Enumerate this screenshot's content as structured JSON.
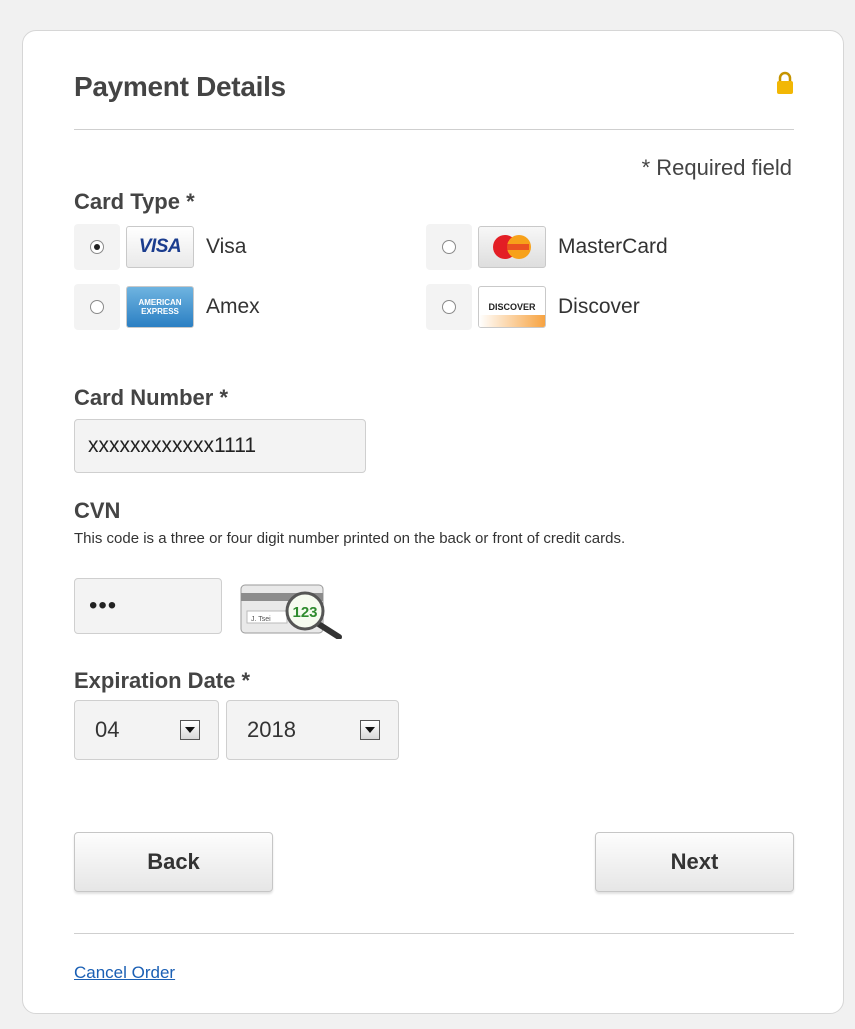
{
  "form": {
    "title": "Payment Details",
    "required_note": "* Required field"
  },
  "card_type": {
    "label": "Card Type *",
    "options": [
      {
        "name": "Visa",
        "logo_text": "VISA",
        "checked": true
      },
      {
        "name": "MasterCard",
        "logo_text": "MasterCard",
        "checked": false
      },
      {
        "name": "Amex",
        "logo_text": "AMERICAN EXPRESS",
        "checked": false
      },
      {
        "name": "Discover",
        "logo_text": "DISCOVER",
        "checked": false
      }
    ]
  },
  "card_number": {
    "label": "Card Number *",
    "value": "xxxxxxxxxxxx1111"
  },
  "cvn": {
    "label": "CVN",
    "hint": "This code is a three or four digit number printed on the back or front of credit cards.",
    "value": "•••",
    "illustration_text": "123",
    "signature_text": "J. Tsei"
  },
  "expiration": {
    "label": "Expiration Date *",
    "month": "04",
    "year": "2018"
  },
  "actions": {
    "back_label": "Back",
    "next_label": "Next",
    "cancel_label": "Cancel Order"
  },
  "colors": {
    "page_bg": "#f1f1f1",
    "card_bg": "#ffffff",
    "lock": "#f2b705",
    "link": "#1a5fb4"
  },
  "icons": [
    "lock-icon",
    "visa-logo",
    "mastercard-logo",
    "amex-logo",
    "discover-logo",
    "cvn-magnifier-icon",
    "dropdown-arrow-icon"
  ]
}
